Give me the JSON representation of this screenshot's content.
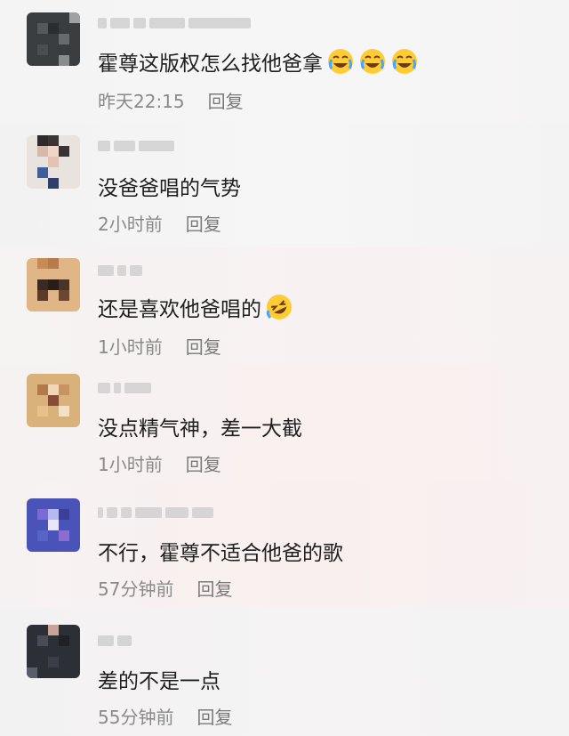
{
  "comments": [
    {
      "text": "霍尊这版权怎么找他爸拿",
      "emojis": [
        "crying-laughing-emoji",
        "crying-laughing-emoji",
        "crying-laughing-emoji"
      ],
      "time": "昨天22:15",
      "reply_label": "回复",
      "avatar": "pixelated-avatar-dark"
    },
    {
      "text": "没爸爸唱的气势",
      "emojis": [],
      "time": "2小时前",
      "reply_label": "回复",
      "avatar": "pixelated-avatar-face"
    },
    {
      "text": "还是喜欢他爸唱的",
      "emojis": [
        "rolling-laughing-emoji"
      ],
      "time": "1小时前",
      "reply_label": "回复",
      "avatar": "pixelated-avatar-warm"
    },
    {
      "text": "没点精气神，差一大截",
      "emojis": [],
      "time": "1小时前",
      "reply_label": "回复",
      "avatar": "pixelated-avatar-blonde"
    },
    {
      "text": "不行，霍尊不适合他爸的歌",
      "emojis": [],
      "time": "57分钟前",
      "reply_label": "回复",
      "avatar": "pixelated-avatar-blue"
    },
    {
      "text": "差的不是一点",
      "emojis": [],
      "time": "55分钟前",
      "reply_label": "回复",
      "avatar": "pixelated-avatar-dark2"
    }
  ]
}
